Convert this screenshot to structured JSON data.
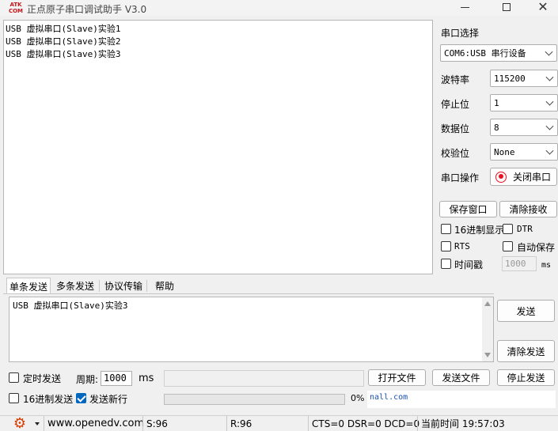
{
  "window": {
    "title": "正点原子串口调试助手 V3.0",
    "logo_top": "ATK",
    "logo_bottom": "COM"
  },
  "receive": {
    "lines": [
      "USB 虚拟串口(Slave)实验1",
      "USB 虚拟串口(Slave)实验2",
      "USB 虚拟串口(Slave)实验3"
    ]
  },
  "settings": {
    "port_section_label": "串口选择",
    "port_value": "COM6:USB 串行设备",
    "baud_label": "波特率",
    "baud_value": "115200",
    "stop_label": "停止位",
    "stop_value": "1",
    "data_label": "数据位",
    "data_value": "8",
    "parity_label": "校验位",
    "parity_value": "None",
    "op_label": "串口操作",
    "close_port_label": "关闭串口",
    "save_window_label": "保存窗口",
    "clear_receive_label": "清除接收",
    "hex_display_label": "16进制显示",
    "dtr_label": "DTR",
    "rts_label": "RTS",
    "autosave_label": "自动保存",
    "timestamp_label": "时间戳",
    "timestamp_value": "1000",
    "timestamp_unit": "ms"
  },
  "tabs": [
    "单条发送",
    "多条发送",
    "协议传输",
    "帮助"
  ],
  "send": {
    "text": "USB 虚拟串口(Slave)实验3",
    "send_label": "发送",
    "clear_send_label": "清除发送",
    "timed_send_label": "定时发送",
    "period_label": "周期:",
    "period_value": "1000",
    "period_unit": "ms",
    "open_file_label": "打开文件",
    "send_file_label": "发送文件",
    "stop_send_label": "停止发送",
    "hex_send_label": "16进制发送",
    "newline_label": "发送新行",
    "progress_percent": "0%",
    "progress_fraction": 0,
    "url_text": "nall.com"
  },
  "status": {
    "website": "www.openedv.com",
    "sent": "S:96",
    "received": "R:96",
    "lines": "CTS=0 DSR=0 DCD=0",
    "time": "当前时间 19:57:03"
  },
  "colors": {
    "accent": "#0067c0",
    "record_red": "#e81123",
    "logo_red": "#c4161c",
    "gear_red": "#d83b01"
  }
}
